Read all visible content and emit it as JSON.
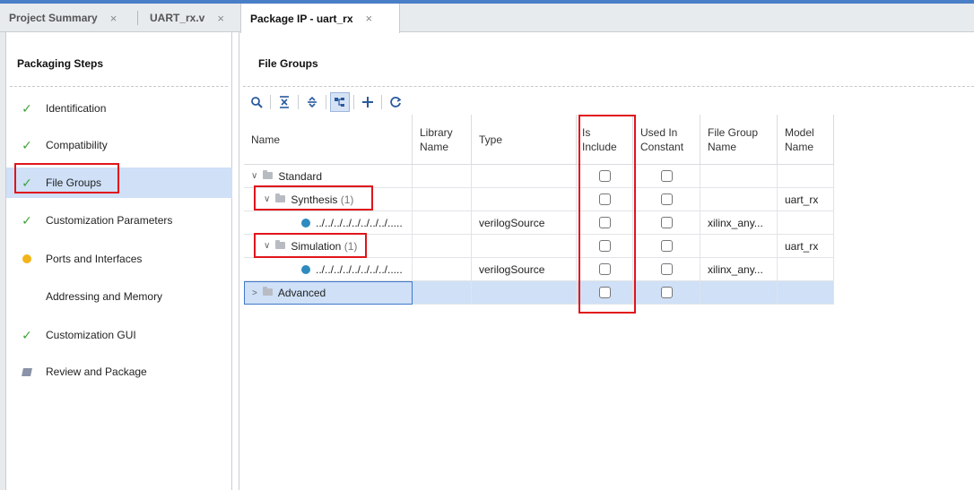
{
  "tabs": [
    {
      "label": "Project Summary",
      "close": "×"
    },
    {
      "label": "UART_rx.v",
      "close": "×"
    },
    {
      "label": "Package IP - uart_rx",
      "close": "×"
    }
  ],
  "left_panel": {
    "title": "Packaging Steps",
    "steps": [
      {
        "label": "Identification",
        "status": "check"
      },
      {
        "label": "Compatibility",
        "status": "check"
      },
      {
        "label": "File Groups",
        "status": "check"
      },
      {
        "label": "Customization Parameters",
        "status": "check"
      },
      {
        "label": "Ports and Interfaces",
        "status": "warning"
      },
      {
        "label": "Addressing and Memory",
        "status": "none"
      },
      {
        "label": "Customization GUI",
        "status": "check"
      },
      {
        "label": "Review and Package",
        "status": "review"
      }
    ]
  },
  "right_panel": {
    "title": "File Groups",
    "toolbar": [
      "search-icon",
      "collapse-all-icon",
      "expand-all-icon",
      "hierarchy-icon",
      "add-icon",
      "refresh-icon"
    ],
    "columns": [
      {
        "line1": "Name",
        "line2": ""
      },
      {
        "line1": "Library",
        "line2": "Name"
      },
      {
        "line1": "Type",
        "line2": ""
      },
      {
        "line1": "Is",
        "line2": "Include"
      },
      {
        "line1": "Used In",
        "line2": "Constant"
      },
      {
        "line1": "File Group",
        "line2": "Name"
      },
      {
        "line1": "Model",
        "line2": "Name"
      }
    ],
    "rows": [
      {
        "name": "Standard",
        "count": "",
        "type": "",
        "file_group": "",
        "model": ""
      },
      {
        "name": "Synthesis",
        "count": "(1)",
        "type": "",
        "file_group": "",
        "model": "uart_rx"
      },
      {
        "name": "../../../../../../../../.....",
        "count": "",
        "type": "verilogSource",
        "file_group": "xilinx_any...",
        "model": ""
      },
      {
        "name": "Simulation",
        "count": "(1)",
        "type": "",
        "file_group": "",
        "model": "uart_rx"
      },
      {
        "name": "../../../../../../../../.....",
        "count": "",
        "type": "verilogSource",
        "file_group": "xilinx_any...",
        "model": ""
      },
      {
        "name": "Advanced",
        "count": "",
        "type": "",
        "file_group": "",
        "model": ""
      }
    ]
  },
  "colors": {
    "check": "#3ea33a",
    "warning": "#f2b418",
    "highlight": "#e0151b",
    "selection": "#cfe0f7"
  }
}
